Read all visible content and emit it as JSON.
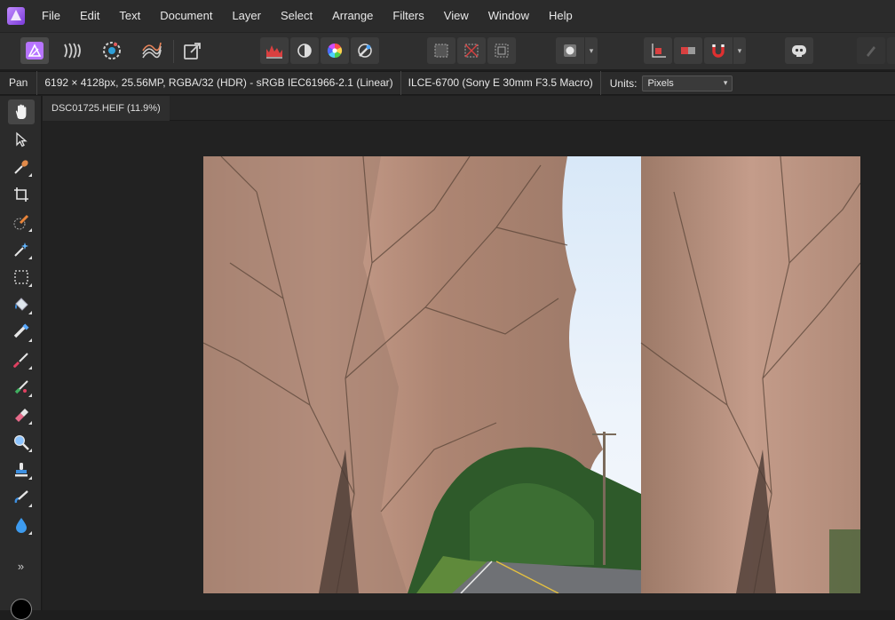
{
  "menubar": {
    "items": [
      "File",
      "Edit",
      "Text",
      "Document",
      "Layer",
      "Select",
      "Arrange",
      "Filters",
      "View",
      "Window",
      "Help"
    ]
  },
  "toolbar": {
    "personas": [
      "photo-persona-icon",
      "liquify-persona-icon",
      "develop-persona-icon",
      "tone-mapping-persona-icon",
      "export-persona-icon"
    ],
    "adjust": [
      "levels-icon",
      "auto-contrast-icon",
      "auto-colour-icon",
      "white-balance-icon"
    ],
    "selection": [
      "quick-mask-icon",
      "deselect-icon",
      "invert-selection-icon"
    ],
    "accent_color": "#b774ff"
  },
  "context": {
    "tool_name": "Pan",
    "image_info": "6192 × 4128px, 25.56MP, RGBA/32 (HDR) - sRGB IEC61966-2.1 (Linear)",
    "camera_info": "ILCE-6700 (Sony E 30mm F3.5 Macro)",
    "units_label": "Units:",
    "units_value": "Pixels"
  },
  "document": {
    "tab_title": "DSC01725.HEIF (11.9%)"
  },
  "tools": [
    "hand-icon",
    "move-icon",
    "colour-picker-icon",
    "crop-icon",
    "selection-brush-icon",
    "magic-wand-icon",
    "marquee-icon",
    "flood-fill-icon",
    "gradient-icon",
    "paint-brush-icon",
    "colour-replacement-icon",
    "erase-brush-icon",
    "dodge-icon",
    "clone-icon",
    "smudge-icon",
    "blur-icon"
  ],
  "tools_more_label": "»"
}
